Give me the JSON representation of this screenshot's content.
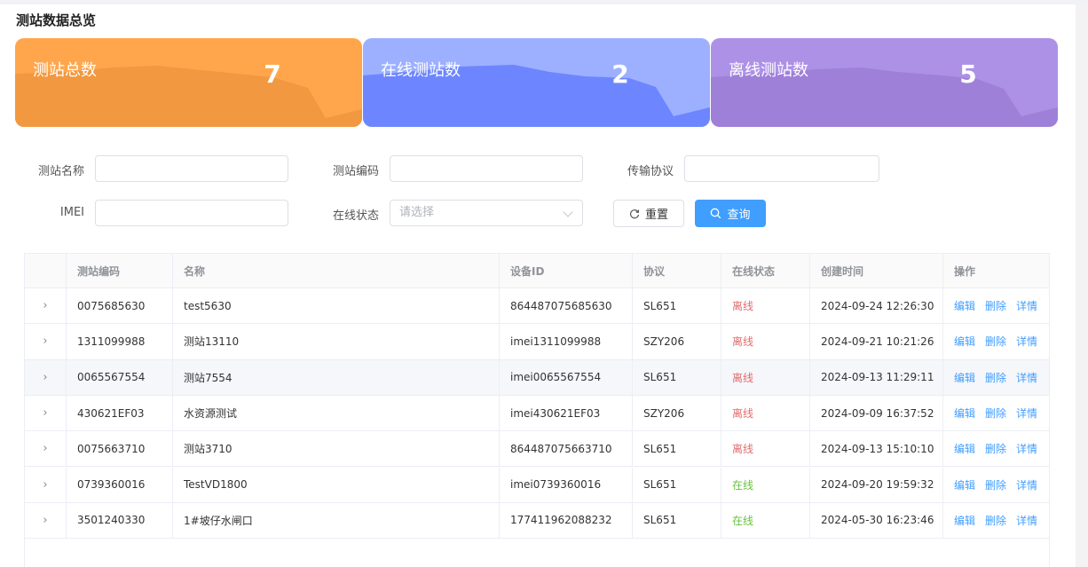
{
  "page": {
    "title": "测站数据总览"
  },
  "summary": [
    {
      "label": "测站总数",
      "value": "7"
    },
    {
      "label": "在线测站数",
      "value": "2"
    },
    {
      "label": "离线测站数",
      "value": "5"
    }
  ],
  "filters": {
    "station_name": {
      "label": "测站名称",
      "value": ""
    },
    "station_code": {
      "label": "测站编码",
      "value": ""
    },
    "protocol": {
      "label": "传输协议",
      "value": ""
    },
    "imei": {
      "label": "IMEI",
      "value": ""
    },
    "online_status": {
      "label": "在线状态",
      "placeholder": "请选择"
    },
    "reset_label": "重置",
    "query_label": "查询"
  },
  "table": {
    "headers": [
      "",
      "测站编码",
      "名称",
      "设备ID",
      "协议",
      "在线状态",
      "创建时间",
      "操作"
    ],
    "actions": {
      "edit": "编辑",
      "delete": "删除",
      "detail": "详情"
    },
    "rows": [
      {
        "code": "0075685630",
        "name": "test5630",
        "device_id": "864487075685630",
        "protocol": "SL651",
        "status": "离线",
        "created": "2024-09-24 12:26:30"
      },
      {
        "code": "1311099988",
        "name": "测站13110",
        "device_id": "imei1311099988",
        "protocol": "SZY206",
        "status": "离线",
        "created": "2024-09-21 10:21:26"
      },
      {
        "code": "0065567554",
        "name": "测站7554",
        "device_id": "imei0065567554",
        "protocol": "SL651",
        "status": "离线",
        "created": "2024-09-13 11:29:11"
      },
      {
        "code": "430621EF03",
        "name": "水资源测试",
        "device_id": "imei430621EF03",
        "protocol": "SZY206",
        "status": "离线",
        "created": "2024-09-09 16:37:52"
      },
      {
        "code": "0075663710",
        "name": "测站3710",
        "device_id": "864487075663710",
        "protocol": "SL651",
        "status": "离线",
        "created": "2024-09-13 15:10:10"
      },
      {
        "code": "0739360016",
        "name": "TestVD1800",
        "device_id": "imei0739360016",
        "protocol": "SL651",
        "status": "在线",
        "created": "2024-09-20 19:59:32"
      },
      {
        "code": "3501240330",
        "name": "1#坡仔水闸口",
        "device_id": "177411962088232",
        "protocol": "SL651",
        "status": "在线",
        "created": "2024-05-30 16:23:46"
      }
    ]
  },
  "colors": {
    "orange": "#ffa64d",
    "blue": "#9db0ff",
    "purple": "#ad91e6",
    "primary": "#409eff",
    "offline": "#e06c6c",
    "online": "#67c23a"
  }
}
